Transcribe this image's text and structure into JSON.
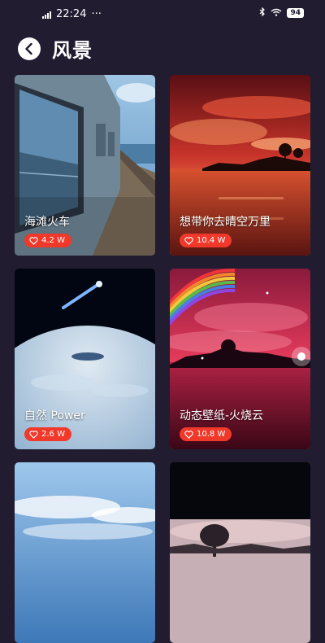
{
  "status": {
    "time": "22:24",
    "dots": "···",
    "battery": "94"
  },
  "header": {
    "title": "风景"
  },
  "cards": [
    {
      "label": "海滩火车",
      "likes": "4.2 W"
    },
    {
      "label": "想带你去晴空万里",
      "likes": "10.4 W"
    },
    {
      "label": "自然 Power",
      "likes": "2.6 W"
    },
    {
      "label": "动态壁纸-火烧云",
      "likes": "10.8 W"
    },
    {
      "label": "",
      "likes": ""
    },
    {
      "label": "",
      "likes": ""
    }
  ]
}
